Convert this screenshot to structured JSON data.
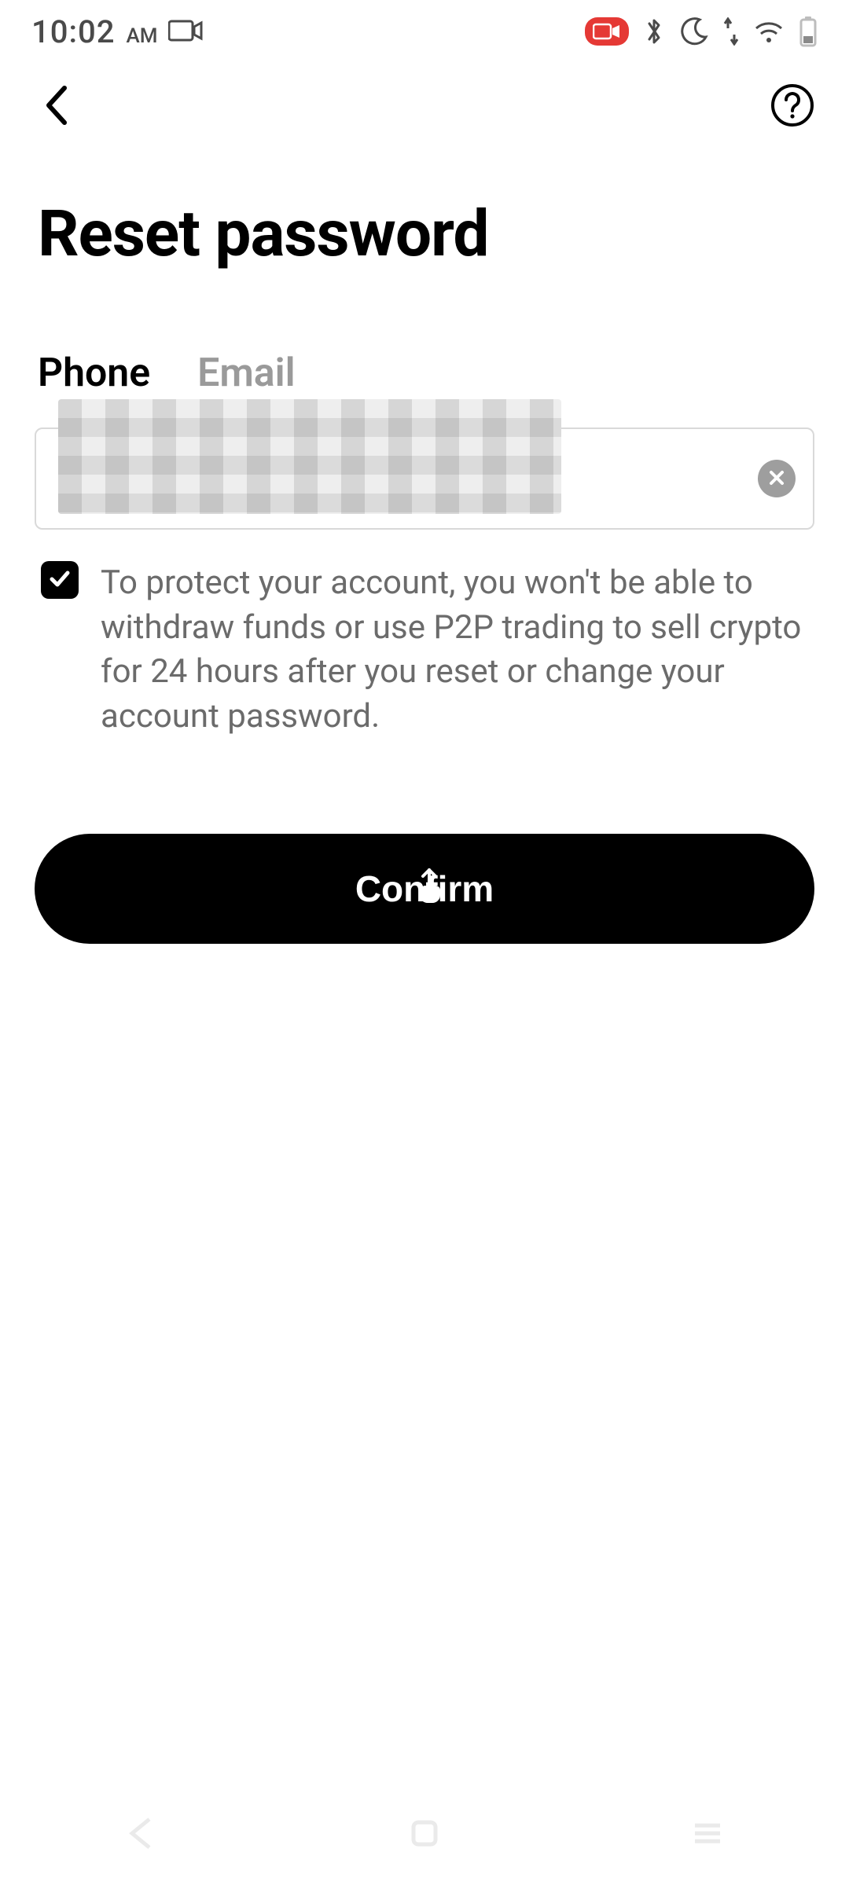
{
  "status": {
    "time": "10:02",
    "ampm": "AM"
  },
  "nav": {
    "back_icon": "chevron-left",
    "help_icon": "question-circle"
  },
  "title": "Reset password",
  "tabs": [
    {
      "label": "Phone",
      "active": true
    },
    {
      "label": "Email",
      "active": false
    }
  ],
  "input": {
    "value": "",
    "placeholder": ""
  },
  "checkbox": {
    "checked": true,
    "text": "To protect your account, you won't be able to withdraw funds or use P2P trading to sell crypto for 24 hours after you reset or change your account password."
  },
  "confirm": {
    "label": "Confirm"
  }
}
